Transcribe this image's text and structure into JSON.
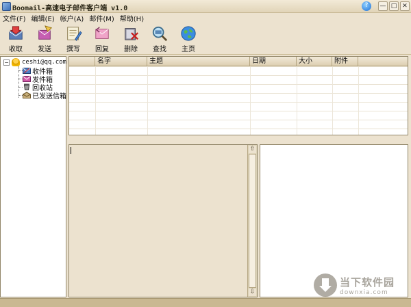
{
  "window": {
    "title": "Boomail-高速电子邮件客户端 v1.0",
    "buttons": {
      "minimize": "—",
      "maximize": "□",
      "close": "✕",
      "help": "?"
    }
  },
  "menu": [
    {
      "label": "文件(F)"
    },
    {
      "label": "编辑(E)"
    },
    {
      "label": "帐户(A)"
    },
    {
      "label": "邮件(M)"
    },
    {
      "label": "帮助(H)"
    }
  ],
  "toolbar": [
    {
      "label": "收取",
      "icon": "receive-icon"
    },
    {
      "label": "发送",
      "icon": "send-icon"
    },
    {
      "label": "撰写",
      "icon": "compose-icon"
    },
    {
      "label": "回复",
      "icon": "reply-icon"
    },
    {
      "label": "删除",
      "icon": "delete-icon"
    },
    {
      "label": "查找",
      "icon": "search-icon"
    },
    {
      "label": "主页",
      "icon": "globe-icon"
    }
  ],
  "tree": {
    "expander": "−",
    "account": "ceshi@qq.com",
    "folders": [
      {
        "label": "收件箱",
        "icon": "inbox-icon"
      },
      {
        "label": "发件箱",
        "icon": "outbox-icon"
      },
      {
        "label": "回收站",
        "icon": "trash-icon"
      },
      {
        "label": "已发送信箱",
        "icon": "sent-icon"
      }
    ]
  },
  "mail_list": {
    "columns": [
      "",
      "名字",
      "主题",
      "日期",
      "大小",
      "附件",
      ""
    ]
  },
  "scrollbar": {
    "up": "⇧",
    "down": "⇩"
  },
  "watermark": {
    "name": "当下软件园",
    "url": "downxia.com"
  },
  "colors": {
    "chrome": "#ece2cf",
    "border": "#8f8466",
    "statusbar": "#c9b892"
  }
}
